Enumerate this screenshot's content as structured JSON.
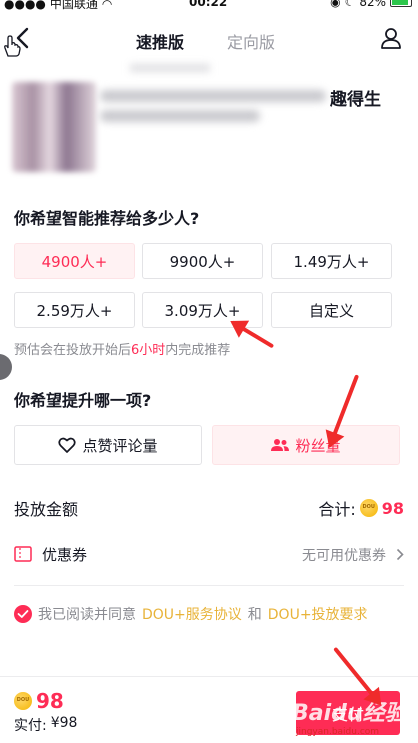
{
  "status_bar": {
    "carrier": "中国联通",
    "time": "00:22",
    "battery": "82%"
  },
  "nav": {
    "tabs": [
      {
        "label": "速推版"
      },
      {
        "label": "定向版"
      }
    ]
  },
  "preview": {
    "title_tail": "趣得生"
  },
  "audience": {
    "question": "你希望智能推荐给多少人?",
    "options": [
      {
        "label": "4900人+"
      },
      {
        "label": "9900人+"
      },
      {
        "label": "1.49万人+"
      },
      {
        "label": "2.59万人+"
      },
      {
        "label": "3.09万人+"
      },
      {
        "label": "自定义"
      }
    ],
    "selected_index": 0,
    "hint_prefix": "预估会在投放开始后",
    "hint_highlight": "6小时",
    "hint_suffix": "内完成推荐"
  },
  "goal": {
    "question": "你希望提升哪一项?",
    "options": [
      {
        "label": "点赞评论量",
        "icon": "heart-icon"
      },
      {
        "label": "粉丝量",
        "icon": "users-icon"
      }
    ],
    "selected_index": 1
  },
  "amount": {
    "label": "投放金额",
    "total_label": "合计:",
    "total_value": "98"
  },
  "coupon": {
    "label": "优惠券",
    "value": "无可用优惠券"
  },
  "agreement": {
    "prefix": "我已阅读并同意",
    "link1": "DOU+服务协议",
    "and": "和",
    "link2": "DOU+投放要求"
  },
  "bottom": {
    "price": "98",
    "actual_label": "实付:",
    "actual_value": "¥98",
    "submit_label": "支付"
  },
  "watermark": {
    "brand": "Baidu经验",
    "url": "jingyan.baidu.com"
  },
  "colors": {
    "accent": "#fe2c55",
    "link": "#e8b339",
    "annotation": "#ef2b2b"
  }
}
